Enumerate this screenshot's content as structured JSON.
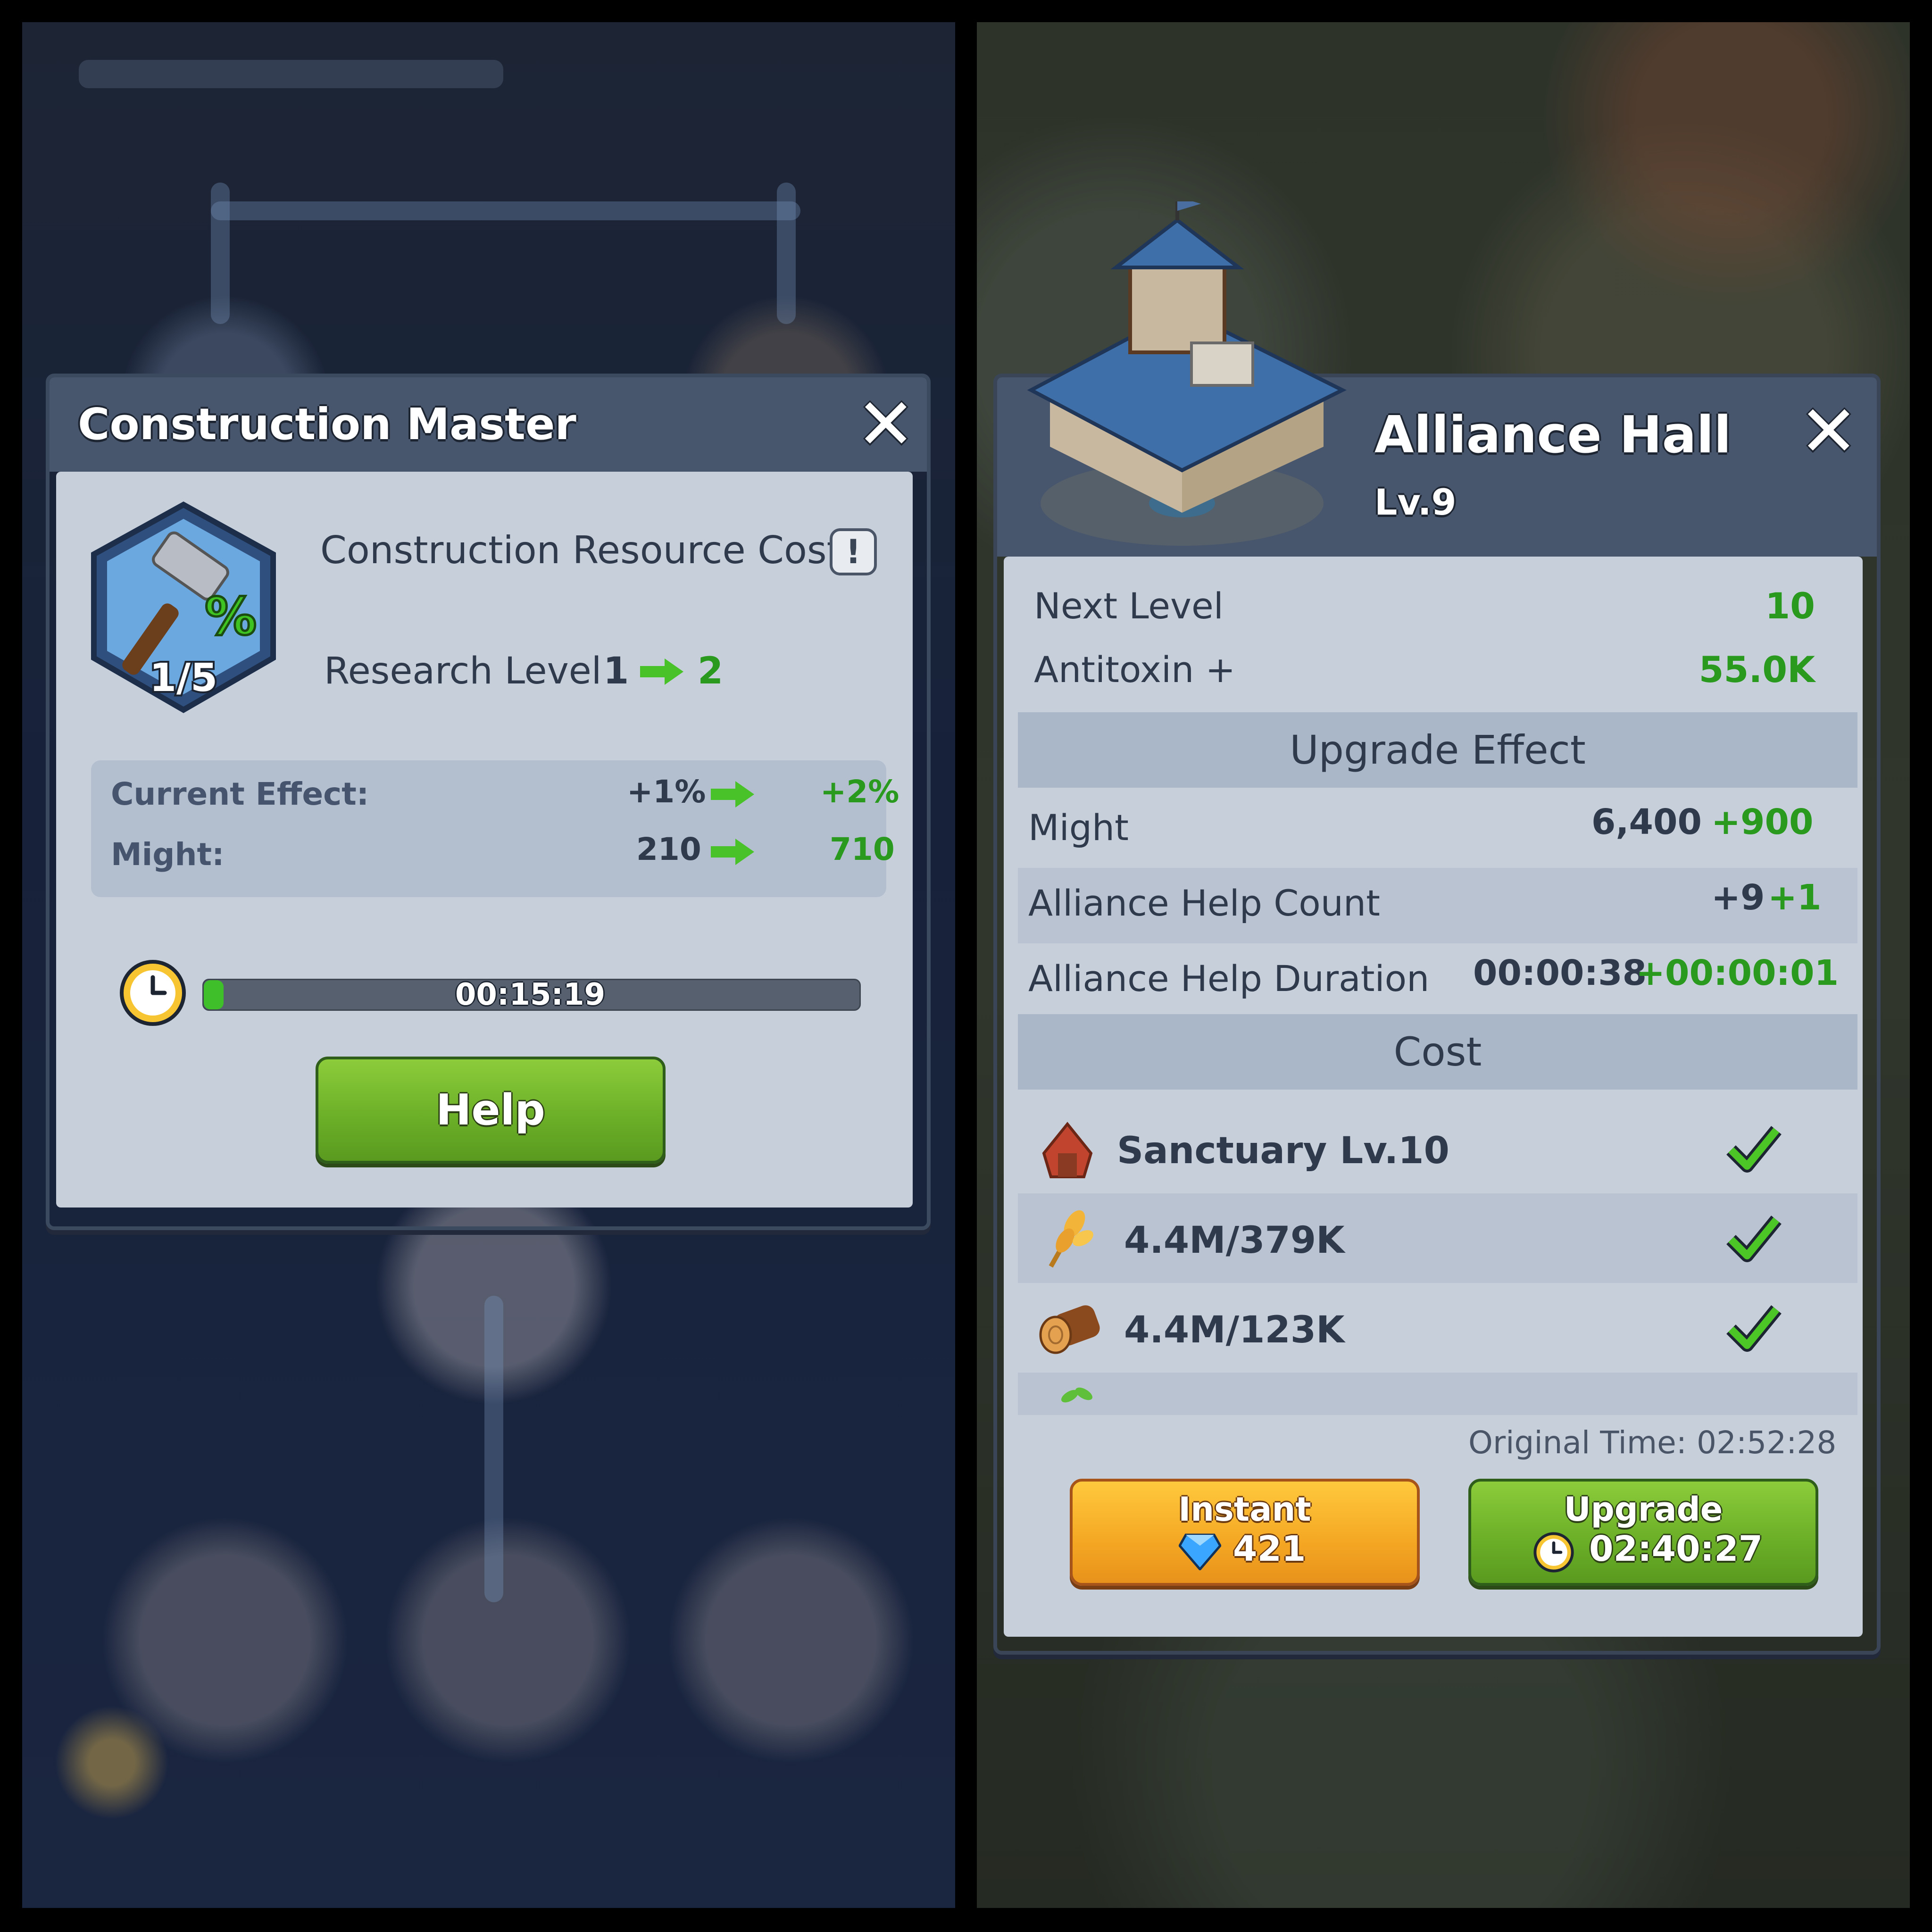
{
  "left": {
    "title": "Construction Master",
    "research": {
      "name": "Construction Resource Cost↓",
      "badge": "1/5",
      "icon_percent": "%",
      "level_label": "Research Level",
      "level_current": "1",
      "level_next": "2"
    },
    "effects": [
      {
        "label": "Current Effect:",
        "current": "+1%",
        "next": "+2%"
      },
      {
        "label": "Might:",
        "current": "210",
        "next": "710"
      }
    ],
    "timer": {
      "value": "00:15:19",
      "progress": 0.03
    },
    "help_button": "Help"
  },
  "right": {
    "title": "Alliance Hall",
    "level": "Lv.9",
    "next_level": {
      "label": "Next Level",
      "value": "10"
    },
    "antitoxin": {
      "label": "Antitoxin +",
      "value": "55.0K"
    },
    "upgrade_effect_header": "Upgrade Effect",
    "effects": [
      {
        "label": "Might",
        "current": "6,400",
        "bonus": "+900"
      },
      {
        "label": "Alliance Help Count",
        "current": "+9",
        "bonus": "+1"
      },
      {
        "label": "Alliance Help Duration",
        "current": "00:00:38",
        "bonus": "+00:00:01"
      }
    ],
    "cost_header": "Cost",
    "costs": [
      {
        "icon": "sanctuary-icon",
        "text": "Sanctuary Lv.10"
      },
      {
        "icon": "wheat-icon",
        "text": "4.4M/379K"
      },
      {
        "icon": "log-icon",
        "text": "4.4M/123K"
      }
    ],
    "original_time_label": "Original Time: 02:52:28",
    "instant_button": {
      "label": "Instant",
      "gems": "421"
    },
    "upgrade_button": {
      "label": "Upgrade",
      "time": "02:40:27"
    }
  },
  "colors": {
    "panel_body": "#c7cfdb",
    "panel_header": "#48566d",
    "accent_green": "#2a9a1f",
    "button_green": "#6aae27",
    "button_orange": "#f4a723"
  }
}
